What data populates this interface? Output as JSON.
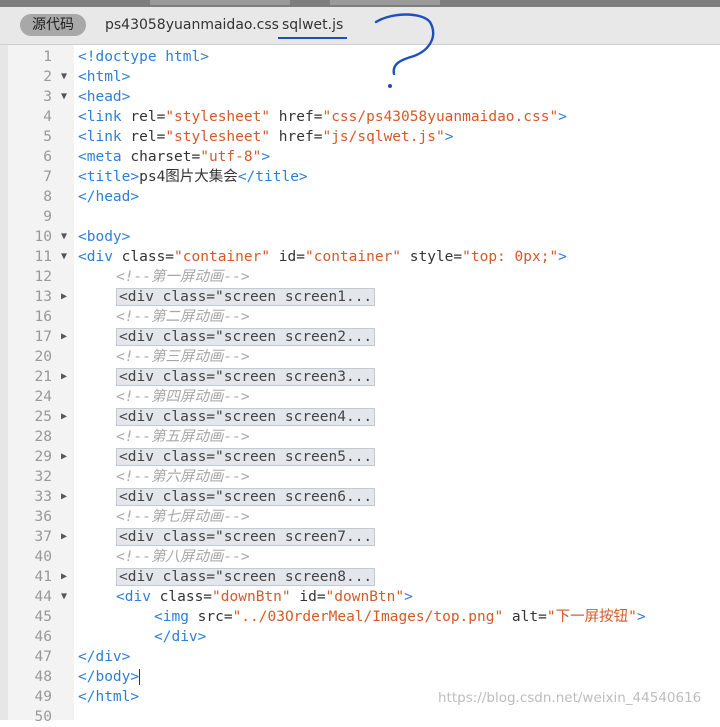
{
  "tabs": {
    "source": "源代码",
    "css_file": "ps43058yuanmaidao.css",
    "js_file": "sqlwet.js"
  },
  "lines": [
    {
      "num": "1",
      "fold": "",
      "indent": 0,
      "tokens": [
        [
          "t",
          "<!doctype html>"
        ]
      ]
    },
    {
      "num": "2",
      "fold": "▼",
      "indent": 0,
      "tokens": [
        [
          "t",
          "<html>"
        ]
      ]
    },
    {
      "num": "3",
      "fold": "▼",
      "indent": 0,
      "tokens": [
        [
          "t",
          "<head>"
        ]
      ]
    },
    {
      "num": "4",
      "fold": "",
      "indent": 0,
      "tokens": [
        [
          "t",
          "<link "
        ],
        [
          "a",
          "rel="
        ],
        [
          "s",
          "\"stylesheet\""
        ],
        [
          "a",
          " href="
        ],
        [
          "s",
          "\"css/ps43058yuanmaidao.css\""
        ],
        [
          "t",
          ">"
        ]
      ]
    },
    {
      "num": "5",
      "fold": "",
      "indent": 0,
      "tokens": [
        [
          "t",
          "<link "
        ],
        [
          "a",
          "rel="
        ],
        [
          "s",
          "\"stylesheet\""
        ],
        [
          "a",
          " href="
        ],
        [
          "s",
          "\"js/sqlwet.js\""
        ],
        [
          "t",
          ">"
        ]
      ]
    },
    {
      "num": "6",
      "fold": "",
      "indent": 0,
      "tokens": [
        [
          "t",
          "<meta "
        ],
        [
          "a",
          "charset="
        ],
        [
          "s",
          "\"utf-8\""
        ],
        [
          "t",
          ">"
        ]
      ]
    },
    {
      "num": "7",
      "fold": "",
      "indent": 0,
      "tokens": [
        [
          "t",
          "<title>"
        ],
        [
          "txt",
          "ps4图片大集会"
        ],
        [
          "t",
          "</title>"
        ]
      ]
    },
    {
      "num": "8",
      "fold": "",
      "indent": 0,
      "tokens": [
        [
          "t",
          "</head>"
        ]
      ]
    },
    {
      "num": "9",
      "fold": "",
      "indent": 0,
      "tokens": []
    },
    {
      "num": "10",
      "fold": "▼",
      "indent": 0,
      "tokens": [
        [
          "t",
          "<body>"
        ]
      ]
    },
    {
      "num": "11",
      "fold": "▼",
      "indent": 0,
      "tokens": [
        [
          "t",
          "<div "
        ],
        [
          "a",
          "class="
        ],
        [
          "s",
          "\"container\""
        ],
        [
          "a",
          " id="
        ],
        [
          "s",
          "\"container\""
        ],
        [
          "a",
          " style="
        ],
        [
          "s",
          "\"top: 0px;\""
        ],
        [
          "t",
          ">"
        ]
      ]
    },
    {
      "num": "12",
      "fold": "",
      "indent": 1,
      "tokens": [
        [
          "c",
          "<!--第一屏动画-->"
        ]
      ]
    },
    {
      "num": "13",
      "fold": "▶",
      "indent": 1,
      "tokens": [
        [
          "collapsed",
          "<div class=\"screen screen1..."
        ]
      ]
    },
    {
      "num": "16",
      "fold": "",
      "indent": 1,
      "tokens": [
        [
          "c",
          "<!--第二屏动画-->"
        ]
      ]
    },
    {
      "num": "17",
      "fold": "▶",
      "indent": 1,
      "tokens": [
        [
          "collapsed",
          "<div class=\"screen screen2..."
        ]
      ]
    },
    {
      "num": "20",
      "fold": "",
      "indent": 1,
      "tokens": [
        [
          "c",
          "<!--第三屏动画-->"
        ]
      ]
    },
    {
      "num": "21",
      "fold": "▶",
      "indent": 1,
      "tokens": [
        [
          "collapsed",
          "<div class=\"screen screen3..."
        ]
      ]
    },
    {
      "num": "24",
      "fold": "",
      "indent": 1,
      "tokens": [
        [
          "c",
          "<!--第四屏动画-->"
        ]
      ]
    },
    {
      "num": "25",
      "fold": "▶",
      "indent": 1,
      "tokens": [
        [
          "collapsed",
          "<div class=\"screen screen4..."
        ]
      ]
    },
    {
      "num": "28",
      "fold": "",
      "indent": 1,
      "tokens": [
        [
          "c",
          "<!--第五屏动画-->"
        ]
      ]
    },
    {
      "num": "29",
      "fold": "▶",
      "indent": 1,
      "tokens": [
        [
          "collapsed",
          "<div class=\"screen screen5..."
        ]
      ]
    },
    {
      "num": "32",
      "fold": "",
      "indent": 1,
      "tokens": [
        [
          "c",
          "<!--第六屏动画-->"
        ]
      ]
    },
    {
      "num": "33",
      "fold": "▶",
      "indent": 1,
      "tokens": [
        [
          "collapsed",
          "<div class=\"screen screen6..."
        ]
      ]
    },
    {
      "num": "36",
      "fold": "",
      "indent": 1,
      "tokens": [
        [
          "c",
          "<!--第七屏动画-->"
        ]
      ]
    },
    {
      "num": "37",
      "fold": "▶",
      "indent": 1,
      "tokens": [
        [
          "collapsed",
          "<div class=\"screen screen7..."
        ]
      ]
    },
    {
      "num": "40",
      "fold": "",
      "indent": 1,
      "tokens": [
        [
          "c",
          "<!--第八屏动画-->"
        ]
      ]
    },
    {
      "num": "41",
      "fold": "▶",
      "indent": 1,
      "tokens": [
        [
          "collapsed",
          "<div class=\"screen screen8..."
        ]
      ]
    },
    {
      "num": "44",
      "fold": "▼",
      "indent": 1,
      "tokens": [
        [
          "t",
          "<div "
        ],
        [
          "a",
          "class="
        ],
        [
          "s",
          "\"downBtn\""
        ],
        [
          "a",
          " id="
        ],
        [
          "s",
          "\"downBtn\""
        ],
        [
          "t",
          ">"
        ]
      ]
    },
    {
      "num": "45",
      "fold": "",
      "indent": 2,
      "tokens": [
        [
          "t",
          "<img "
        ],
        [
          "a",
          "src="
        ],
        [
          "s",
          "\"../03OrderMeal/Images/top.png\""
        ],
        [
          "a",
          " alt="
        ],
        [
          "s",
          "\"下一屏按钮\""
        ],
        [
          "t",
          ">"
        ]
      ]
    },
    {
      "num": "46",
      "fold": "",
      "indent": 2,
      "tokens": [
        [
          "t",
          "</div>"
        ]
      ]
    },
    {
      "num": "47",
      "fold": "",
      "indent": 0,
      "tokens": [
        [
          "t",
          "</div>"
        ]
      ]
    },
    {
      "num": "48",
      "fold": "",
      "indent": 0,
      "tokens": [
        [
          "t",
          "</body>"
        ]
      ],
      "caret": true
    },
    {
      "num": "49",
      "fold": "",
      "indent": 0,
      "tokens": [
        [
          "t",
          "</html>"
        ]
      ]
    },
    {
      "num": "50",
      "fold": "",
      "indent": 0,
      "tokens": []
    }
  ],
  "watermark": "https://blog.csdn.net/weixin_44540616",
  "colors": {
    "tag": "#2f7ed8",
    "string": "#d35a2a",
    "comment": "#a7a7a7",
    "annotation": "#1f4fbf"
  }
}
